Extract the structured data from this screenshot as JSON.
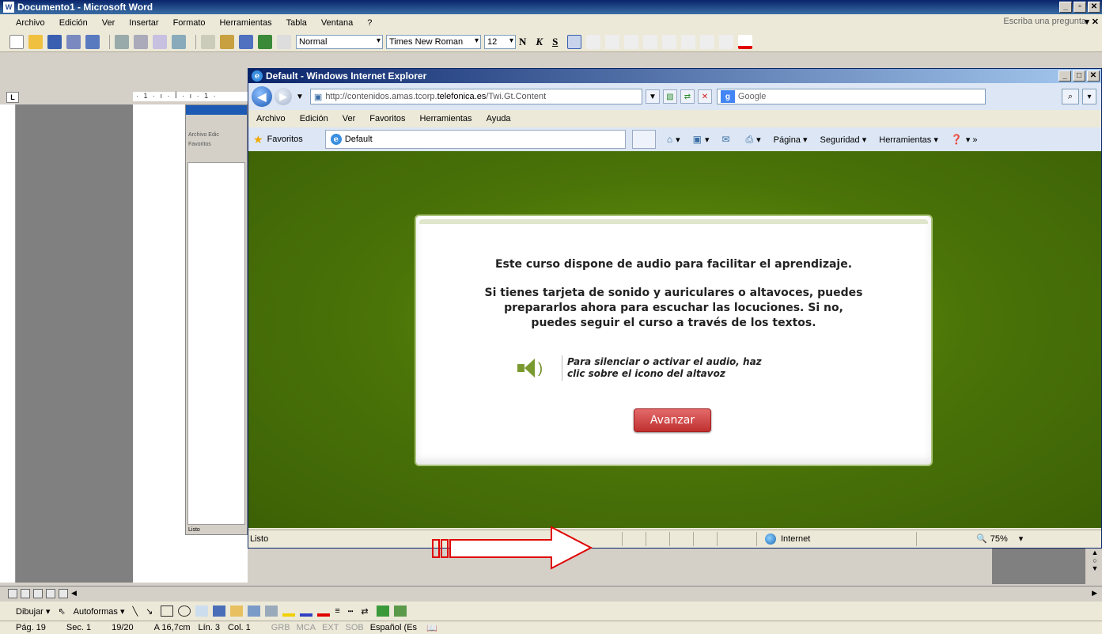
{
  "word": {
    "title": "Documento1 - Microsoft Word",
    "menu": [
      "Archivo",
      "Edición",
      "Ver",
      "Insertar",
      "Formato",
      "Herramientas",
      "Tabla",
      "Ventana",
      "?"
    ],
    "ask_placeholder": "Escriba una pregunta",
    "style_combo": "Normal",
    "font_combo": "Times New Roman",
    "size_combo": "12",
    "format_buttons": [
      "N",
      "K",
      "S"
    ],
    "ruler_tab": "L",
    "ruler_text": "· 1 · ı · ꟾ · ı · 1 ·",
    "draw_label": "Dibujar ▾",
    "autoformas_label": "Autoformas ▾",
    "status": {
      "page": "Pág. 19",
      "section": "Sec. 1",
      "pages": "19/20",
      "position": "A 16,7cm",
      "line": "Lín. 3",
      "col": "Col. 1",
      "grb": "GRB",
      "mca": "MCA",
      "ext": "EXT",
      "sob": "SOB",
      "language": "Español (Es"
    }
  },
  "mini_ie": {
    "menu_text": "Archivo  Edic",
    "fav_text": "Favoritos",
    "status": "Listo"
  },
  "ie": {
    "title": "Default - Windows Internet Explorer",
    "url_prefix": "http://contenidos.amas.tcorp.",
    "url_domain": "telefonica.es",
    "url_suffix": "/Twi.Gt.Content",
    "search_placeholder": "Google",
    "menu": [
      "Archivo",
      "Edición",
      "Ver",
      "Favoritos",
      "Herramientas",
      "Ayuda"
    ],
    "favorites_label": "Favoritos",
    "tab_label": "Default",
    "commands": {
      "page": "Página ▾",
      "security": "Seguridad ▾",
      "tools": "Herramientas ▾"
    },
    "status_text": "Listo",
    "zone": "Internet",
    "zoom": "75%"
  },
  "course": {
    "line1": "Este curso dispone de audio para facilitar el aprendizaje.",
    "para2_line1": "Si tienes tarjeta de sonido y auriculares o altavoces, puedes",
    "para2_line2": "prepararlos ahora para escuchar las locuciones. Si no,",
    "para2_line3": "puedes seguir el curso a través de los textos.",
    "audio_hint_line1": "Para silenciar o activar el audio, haz",
    "audio_hint_line2": "clic sobre el icono del altavoz",
    "button_label": "Avanzar"
  },
  "colors": {
    "green_bg": "#4a7308",
    "button_red": "#c03030",
    "arrow_red": "#e00000"
  }
}
